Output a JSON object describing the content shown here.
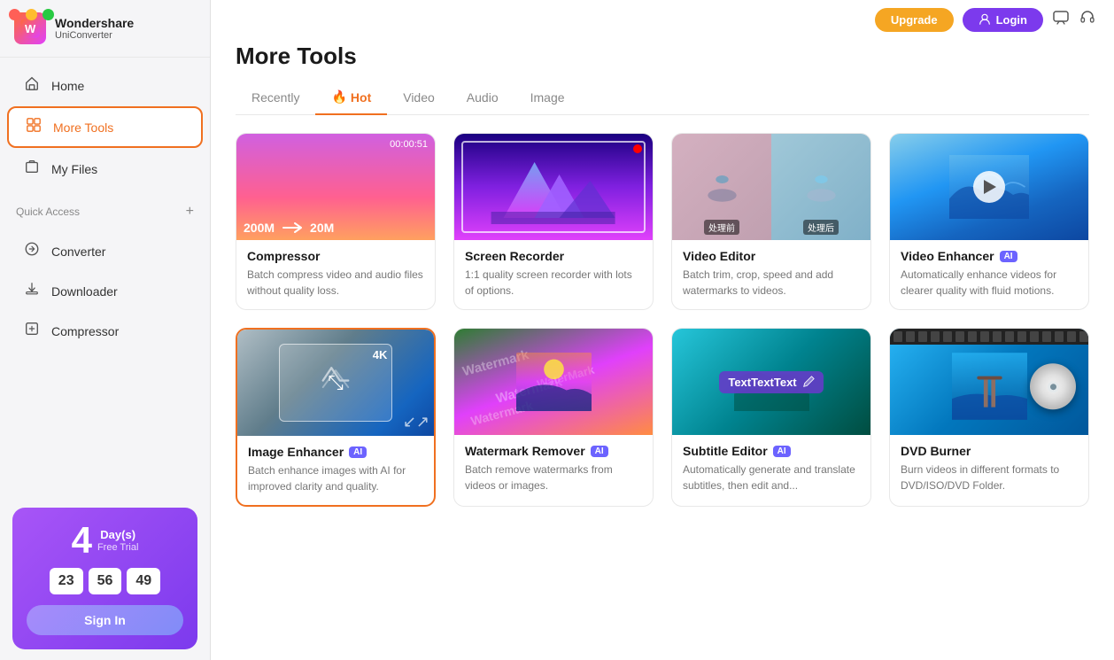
{
  "app": {
    "name": "Wondershare",
    "subname": "UniConverter",
    "logo_text": "W"
  },
  "window_controls": {
    "close": "●",
    "minimize": "●",
    "maximize": "●"
  },
  "topbar": {
    "upgrade_label": "Upgrade",
    "login_label": "Login"
  },
  "sidebar": {
    "nav_items": [
      {
        "id": "home",
        "label": "Home",
        "icon": "🏠"
      },
      {
        "id": "more-tools",
        "label": "More Tools",
        "icon": "🔧",
        "active": true
      },
      {
        "id": "my-files",
        "label": "My Files",
        "icon": "📄"
      }
    ],
    "quick_access_label": "Quick Access",
    "quick_access_items": [
      {
        "id": "converter",
        "label": "Converter",
        "icon": "🔄"
      },
      {
        "id": "downloader",
        "label": "Downloader",
        "icon": "⬇"
      },
      {
        "id": "compressor",
        "label": "Compressor",
        "icon": "🗜"
      }
    ],
    "trial": {
      "days_num": "4",
      "days_label": "Day(s)",
      "free_trial": "Free Trial",
      "hours": "23",
      "minutes": "56",
      "seconds": "49",
      "sign_in_label": "Sign In"
    }
  },
  "main": {
    "title": "More Tools",
    "tabs": [
      {
        "id": "recently",
        "label": "Recently"
      },
      {
        "id": "hot",
        "label": "Hot",
        "icon": "🔥",
        "active": true
      },
      {
        "id": "video",
        "label": "Video"
      },
      {
        "id": "audio",
        "label": "Audio"
      },
      {
        "id": "image",
        "label": "Image"
      }
    ],
    "cards": [
      {
        "id": "compressor",
        "title": "Compressor",
        "desc": "Batch compress video and audio files without quality loss.",
        "size_from": "200M",
        "size_to": "20M",
        "timer": "00:00:51",
        "ai": false,
        "selected": false
      },
      {
        "id": "screen-recorder",
        "title": "Screen Recorder",
        "desc": "1:1 quality screen recorder with lots of options.",
        "ai": false,
        "selected": false
      },
      {
        "id": "video-editor",
        "title": "Video Editor",
        "desc": "Batch trim, crop, speed and add watermarks to videos.",
        "label_before": "处理前",
        "label_after": "处理后",
        "ai": false,
        "selected": false
      },
      {
        "id": "video-enhancer",
        "title": "Video Enhancer",
        "desc": "Automatically enhance videos for clearer quality with fluid motions.",
        "ai": true,
        "selected": false
      },
      {
        "id": "image-enhancer",
        "title": "Image Enhancer",
        "desc": "Batch enhance images with AI for improved clarity and quality.",
        "ai": true,
        "selected": true,
        "badge_4k": "4K"
      },
      {
        "id": "watermark-remover",
        "title": "Watermark Remover",
        "desc": "Batch remove watermarks from videos or images.",
        "ai": true,
        "watermark_texts": [
          "Watermark",
          "Watermark",
          "WaterMark"
        ],
        "selected": false
      },
      {
        "id": "subtitle-editor",
        "title": "Subtitle Editor",
        "desc": "Automatically generate and translate subtitles, then edit and...",
        "ai": true,
        "subtitle_text": "TextTextText",
        "selected": false
      },
      {
        "id": "dvd-burner",
        "title": "DVD Burner",
        "desc": "Burn videos in different formats to DVD/ISO/DVD Folder.",
        "ai": false,
        "selected": false
      }
    ]
  }
}
